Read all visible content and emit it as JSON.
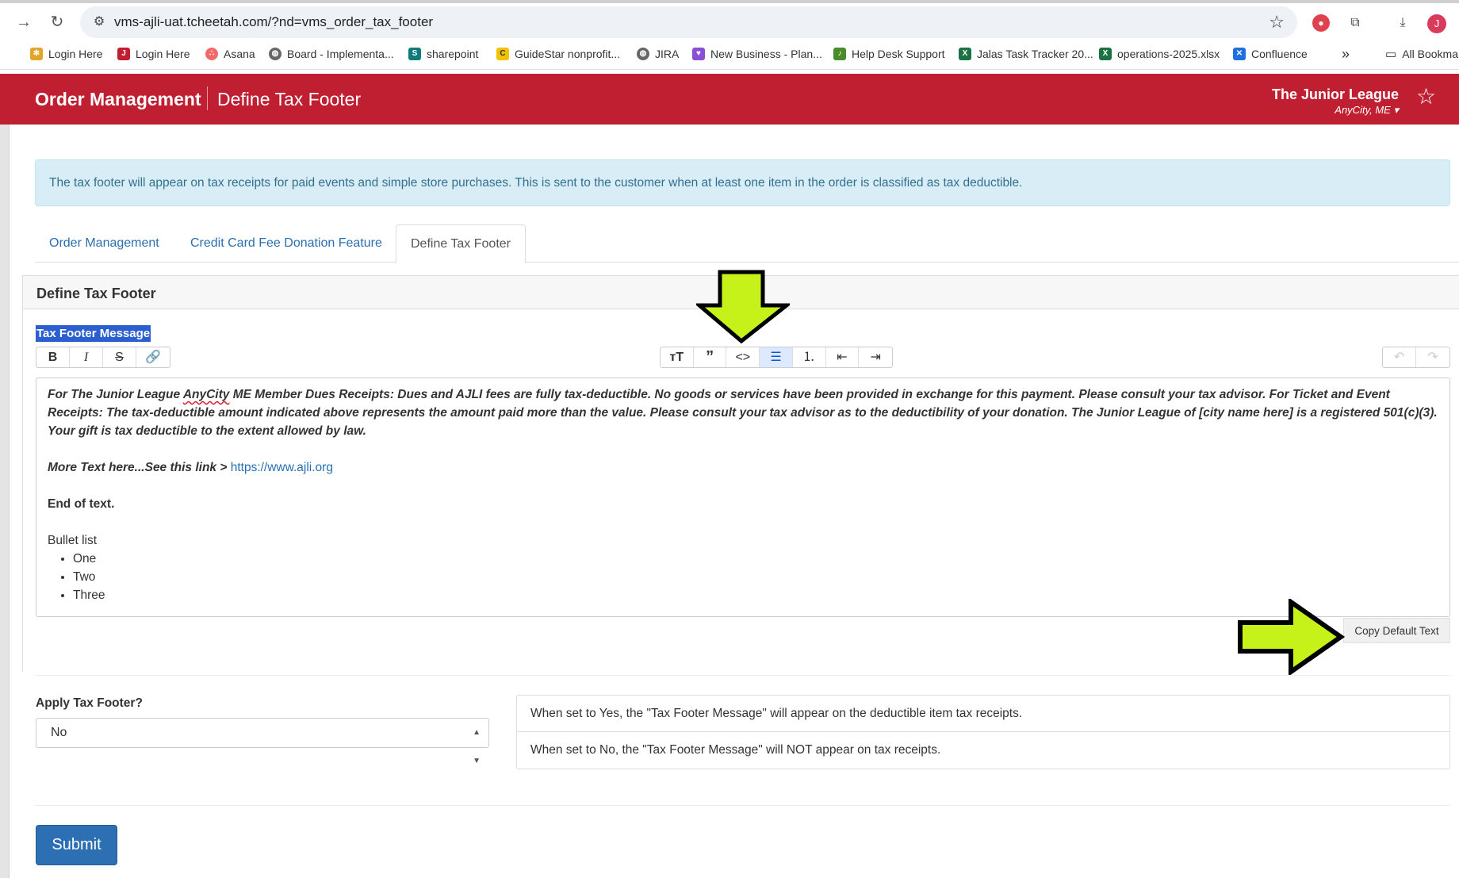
{
  "browser": {
    "url": "vms-ajli-uat.tcheetah.com/?nd=vms_order_tax_footer",
    "profile_initial": "J"
  },
  "bookmarks": [
    {
      "label": "Login Here"
    },
    {
      "label": "Login Here"
    },
    {
      "label": "Asana"
    },
    {
      "label": "Board - Implementa..."
    },
    {
      "label": "sharepoint"
    },
    {
      "label": "GuideStar nonprofit..."
    },
    {
      "label": "JIRA"
    },
    {
      "label": "New Business - Plan..."
    },
    {
      "label": "Help Desk Support"
    },
    {
      "label": "Jalas Task Tracker 20..."
    },
    {
      "label": "operations-2025.xlsx"
    },
    {
      "label": "Confluence"
    },
    {
      "label": "All Bookmarks"
    }
  ],
  "header": {
    "title": "Order Management",
    "subtitle": "Define Tax Footer",
    "org_name": "The Junior League",
    "org_city": "AnyCity, ME"
  },
  "alert": {
    "text": "The tax footer will appear on tax receipts for paid events and simple store purchases. This is sent to the customer when at least one item in the order is classified as tax deductible."
  },
  "tabs": [
    {
      "label": "Order Management"
    },
    {
      "label": "Credit Card Fee Donation Feature"
    },
    {
      "label": "Define Tax Footer"
    }
  ],
  "panel": {
    "title": "Define Tax Footer",
    "field_label": "Tax Footer Message"
  },
  "editor": {
    "para1_prefix": "For The Junior League ",
    "para1_misspelled": "AnyCity",
    "para1_rest": " ME  Member Dues Receipts: Dues and AJLI fees are fully tax-deductible. No goods or services have been provided in exchange for this payment. Please consult your tax advisor. For Ticket and Event Receipts: The tax-deductible amount indicated above represents the amount paid more than the value. Please consult your tax advisor as to the deductibility of your donation. The Junior League of  [city name here] is a registered 501(c)(3). Your gift is tax deductible to the extent allowed by law.",
    "para2_text": "More Text here...See this link > ",
    "para2_link": "https://www.ajli.org",
    "para3": "End of text.",
    "list_title": "Bullet list",
    "list_items": [
      "One",
      "Two",
      "Three"
    ]
  },
  "copy_default_label": "Copy Default Text",
  "apply": {
    "label": "Apply Tax Footer?",
    "selected": "No",
    "help_yes": "When set to Yes, the \"Tax Footer Message\" will appear on the deductible item tax receipts.",
    "help_no": "When set to No, the \"Tax Footer Message\" will NOT appear on tax receipts."
  },
  "submit_label": "Submit",
  "colors": {
    "brand_red": "#c01f32",
    "alert_bg": "#d9edf7",
    "primary_blue": "#2d6fb3",
    "annotation_arrow": "#c6f21a"
  }
}
